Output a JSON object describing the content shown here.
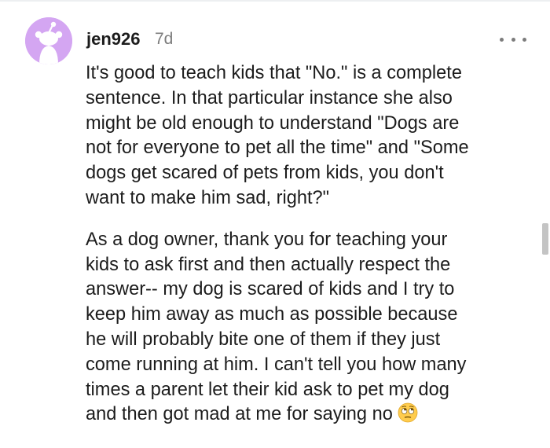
{
  "comment": {
    "username": "jen926",
    "age": "7d",
    "more_icon": "more-horizontal-icon",
    "paragraphs": [
      {
        "lines": [
          "It's good to teach kids that \"No.\" is a complete",
          "sentence. In that particular instance she also",
          "might be old enough to understand \"Dogs are",
          "not for everyone to pet all the time\" and \"Some",
          "dogs get scared of pets from kids, you don't",
          "want to make him sad, right?\""
        ]
      },
      {
        "lines": [
          "As a dog owner, thank you for teaching your",
          "kids to ask first and then actually respect the",
          "answer-- my dog is scared of kids and I try to",
          "keep him away as much as possible because",
          "he will probably bite one of them if they just",
          "come running at him. I can't tell you how many",
          "times a parent let their kid ask to pet my dog",
          "and then got mad at me for saying no"
        ],
        "trailing_emoji": "face-with-rolling-eyes-icon"
      }
    ]
  },
  "colors": {
    "avatar_background": "#d4a6f2",
    "avatar_figure": "#ffffff",
    "text": "#1c1c1c",
    "muted": "#7c7c7c",
    "emoji": "#ffcc4d"
  }
}
